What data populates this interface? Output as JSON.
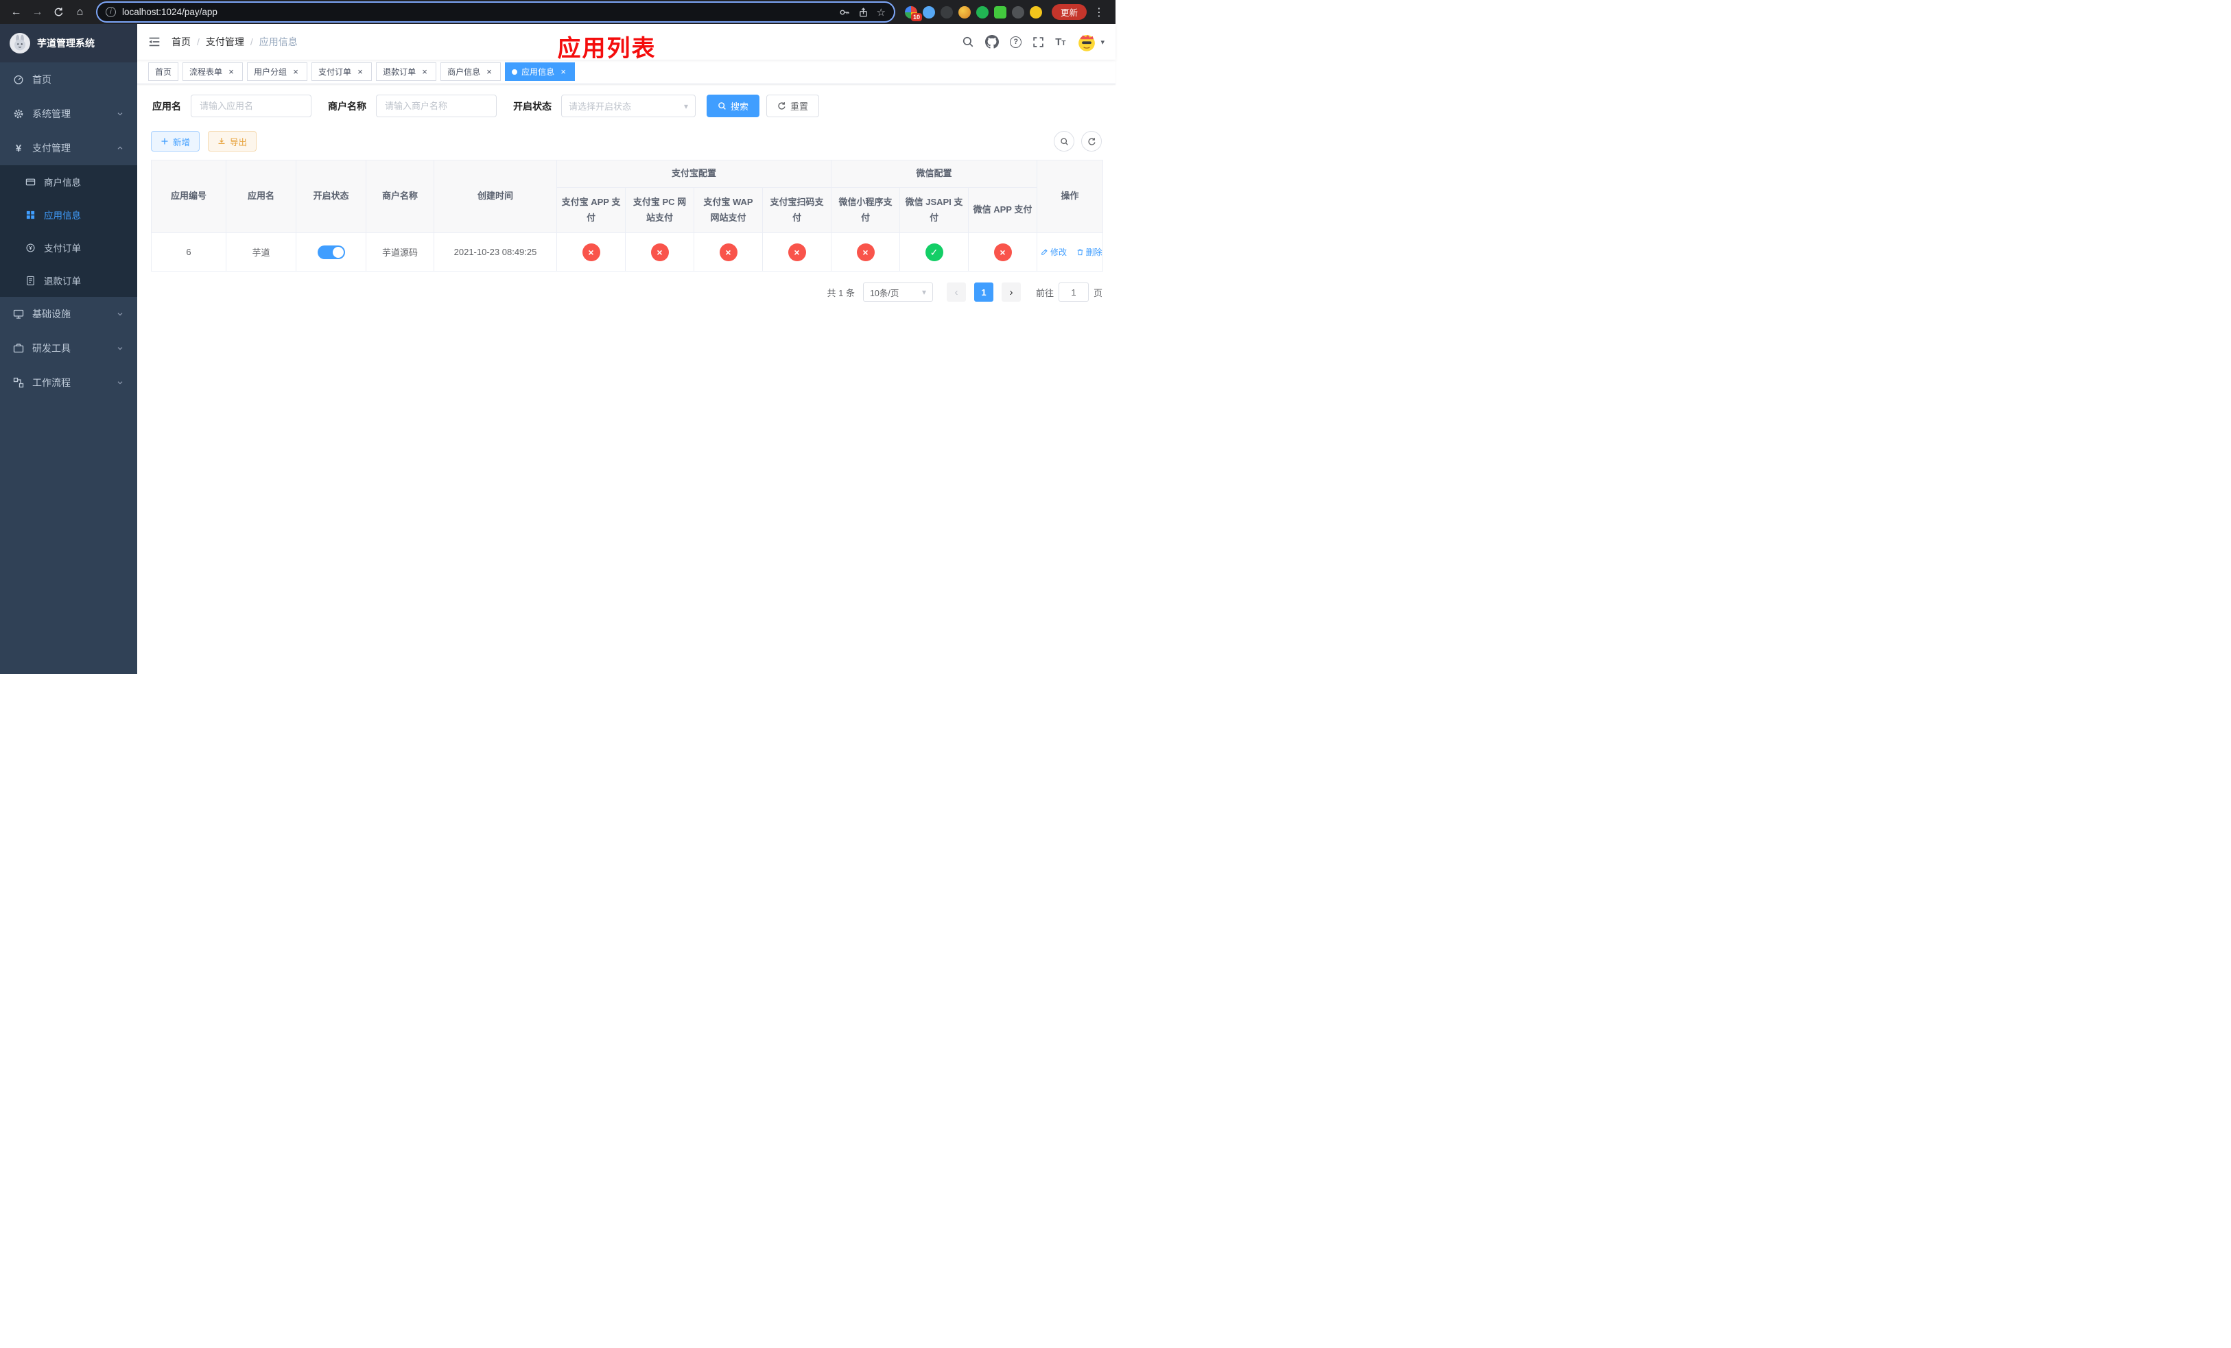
{
  "browser": {
    "url": "localhost:1024/pay/app",
    "update_label": "更新",
    "ext_badge": "10"
  },
  "sidebar": {
    "title": "芋道管理系统",
    "items": [
      {
        "label": "首页"
      },
      {
        "label": "系统管理",
        "expandable": true
      },
      {
        "label": "支付管理",
        "expandable": true,
        "expanded": true,
        "children": [
          {
            "label": "商户信息"
          },
          {
            "label": "应用信息",
            "active": true
          },
          {
            "label": "支付订单"
          },
          {
            "label": "退款订单"
          }
        ]
      },
      {
        "label": "基础设施",
        "expandable": true
      },
      {
        "label": "研发工具",
        "expandable": true
      },
      {
        "label": "工作流程",
        "expandable": true
      }
    ]
  },
  "header": {
    "breadcrumb": [
      "首页",
      "支付管理",
      "应用信息"
    ],
    "annotation": "应用列表"
  },
  "tabs": [
    {
      "label": "首页"
    },
    {
      "label": "流程表单"
    },
    {
      "label": "用户分组"
    },
    {
      "label": "支付订单"
    },
    {
      "label": "退款订单"
    },
    {
      "label": "商户信息"
    },
    {
      "label": "应用信息",
      "active": true
    }
  ],
  "filters": {
    "app_name_label": "应用名",
    "app_name_placeholder": "请输入应用名",
    "merchant_label": "商户名称",
    "merchant_placeholder": "请输入商户名称",
    "status_label": "开启状态",
    "status_placeholder": "请选择开启状态",
    "search_label": "搜索",
    "reset_label": "重置"
  },
  "toolbar": {
    "add_label": "新增",
    "export_label": "导出"
  },
  "table": {
    "group_headers": {
      "alipay": "支付宝配置",
      "wechat": "微信配置"
    },
    "columns": [
      "应用编号",
      "应用名",
      "开启状态",
      "商户名称",
      "创建时间",
      "支付宝 APP 支付",
      "支付宝 PC 网站支付",
      "支付宝 WAP 网站支付",
      "支付宝扫码支付",
      "微信小程序支付",
      "微信 JSAPI 支付",
      "微信 APP 支付",
      "操作"
    ],
    "rows": [
      {
        "id": "6",
        "name": "芋道",
        "enabled": true,
        "merchant": "芋道源码",
        "created": "2021-10-23 08:49:25",
        "configs": [
          "no",
          "no",
          "no",
          "no",
          "no",
          "yes",
          "no"
        ],
        "edit_label": "修改",
        "delete_label": "删除"
      }
    ]
  },
  "pagination": {
    "total_label": "共 1 条",
    "page_size": "10条/页",
    "current_page": "1",
    "goto_label": "前往",
    "goto_value": "1",
    "unit_label": "页"
  },
  "glyphs": {
    "back": "←",
    "forward": "→",
    "home": "⌂",
    "star": "☆",
    "dots": "⋮",
    "info": "i",
    "slash": "/",
    "caret_down": "▾",
    "yen": "¥",
    "check": "✓",
    "cross": "×",
    "close": "×",
    "prev": "‹",
    "next": "›",
    "question": "?",
    "font_big": "T",
    "font_small": "T"
  },
  "colors": {
    "accent": "#409eff",
    "danger": "#f9544b",
    "success": "#13ce66",
    "warning": "#e6a23c",
    "annotation": "#f40d0d"
  }
}
